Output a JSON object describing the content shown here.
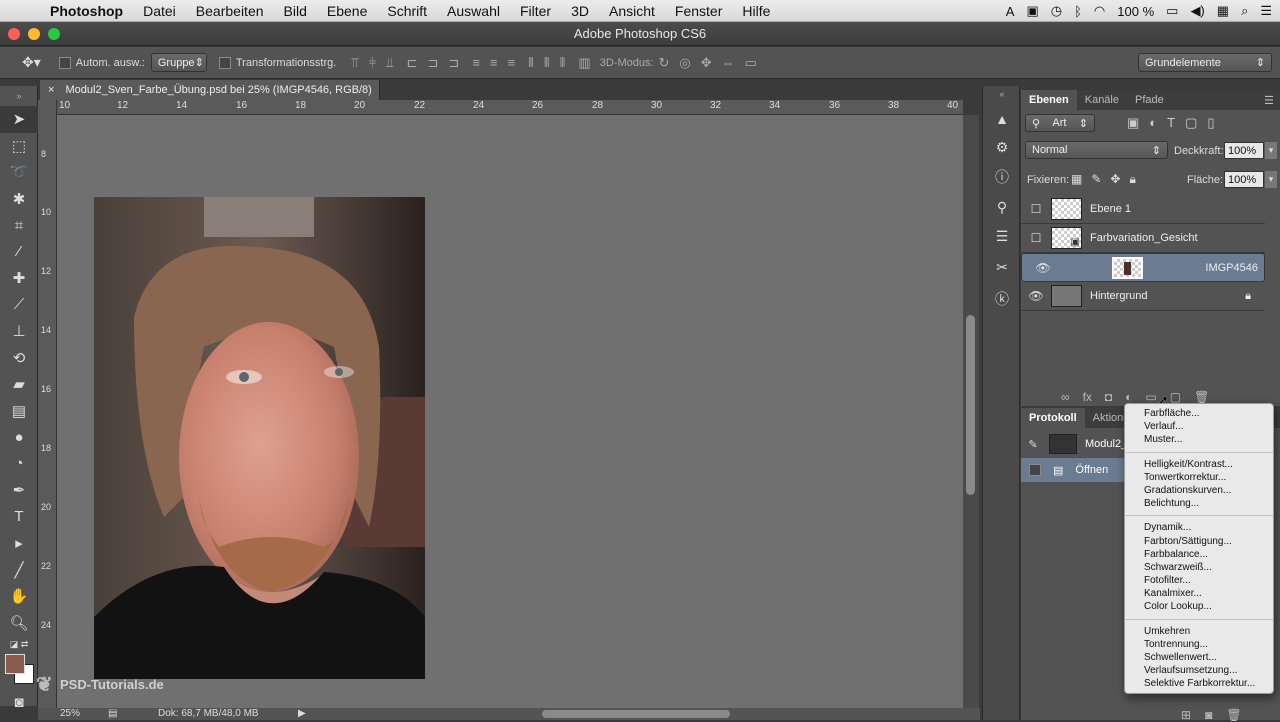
{
  "menubar": {
    "app": "Photoshop",
    "items": [
      "Datei",
      "Bearbeiten",
      "Bild",
      "Ebene",
      "Schrift",
      "Auswahl",
      "Filter",
      "3D",
      "Ansicht",
      "Fenster",
      "Hilfe"
    ],
    "battery": "100 %"
  },
  "window": {
    "title": "Adobe Photoshop CS6"
  },
  "options": {
    "auto_select_label": "Autom. ausw.:",
    "auto_select_value": "Gruppe",
    "transform_label": "Transformationsstrg.",
    "mode3d_label": "3D-Modus:",
    "workspace": "Grundelemente"
  },
  "document": {
    "tab_label": "Modul2_Sven_Farbe_Übung.psd bei 25% (IMGP4546, RGB/8)",
    "ruler_h": [
      "10",
      "12",
      "14",
      "16",
      "18",
      "20",
      "22",
      "24",
      "26",
      "28",
      "30",
      "32",
      "34",
      "36",
      "38",
      "40"
    ],
    "ruler_v": [
      "8",
      "10",
      "12",
      "14",
      "16",
      "18",
      "20",
      "22",
      "24"
    ],
    "zoom": "25%",
    "doc_info": "Dok: 68,7 MB/48,0 MB",
    "watermark": "PSD-Tutorials.de"
  },
  "layers_panel": {
    "tabs": [
      "Ebenen",
      "Kanäle",
      "Pfade"
    ],
    "filter": "Art",
    "blend_mode": "Normal",
    "opacity_label": "Deckkraft:",
    "opacity": "100%",
    "lock_label": "Fixieren:",
    "fill_label": "Fläche:",
    "fill": "100%",
    "layers": [
      {
        "name": "Ebene 1",
        "visible": false
      },
      {
        "name": "Farbvariation_Gesicht",
        "visible": false
      },
      {
        "name": "IMGP4546",
        "visible": true,
        "selected": true
      },
      {
        "name": "Hintergrund",
        "visible": true,
        "locked": true
      }
    ]
  },
  "protocol_panel": {
    "tabs": [
      "Protokoll",
      "Aktionen"
    ],
    "snapshot": "Modul2_S",
    "history": [
      "Öffnen"
    ]
  },
  "adjustment_menu": {
    "group1": [
      "Farbfläche...",
      "Verlauf...",
      "Muster..."
    ],
    "group2": [
      "Helligkeit/Kontrast...",
      "Tonwertkorrektur...",
      "Gradationskurven...",
      "Belichtung..."
    ],
    "group3": [
      "Dynamik...",
      "Farbton/Sättigung...",
      "Farbbalance...",
      "Schwarzweiß...",
      "Fotofilter...",
      "Kanalmixer...",
      "Color Lookup..."
    ],
    "group4": [
      "Umkehren",
      "Tontrennung...",
      "Schwellenwert...",
      "Verlaufsumsetzung...",
      "Selektive Farbkorrektur..."
    ]
  },
  "colors": {
    "foreground": "#8a5a4c",
    "background": "#ffffff",
    "selection": "#6b7b91"
  }
}
